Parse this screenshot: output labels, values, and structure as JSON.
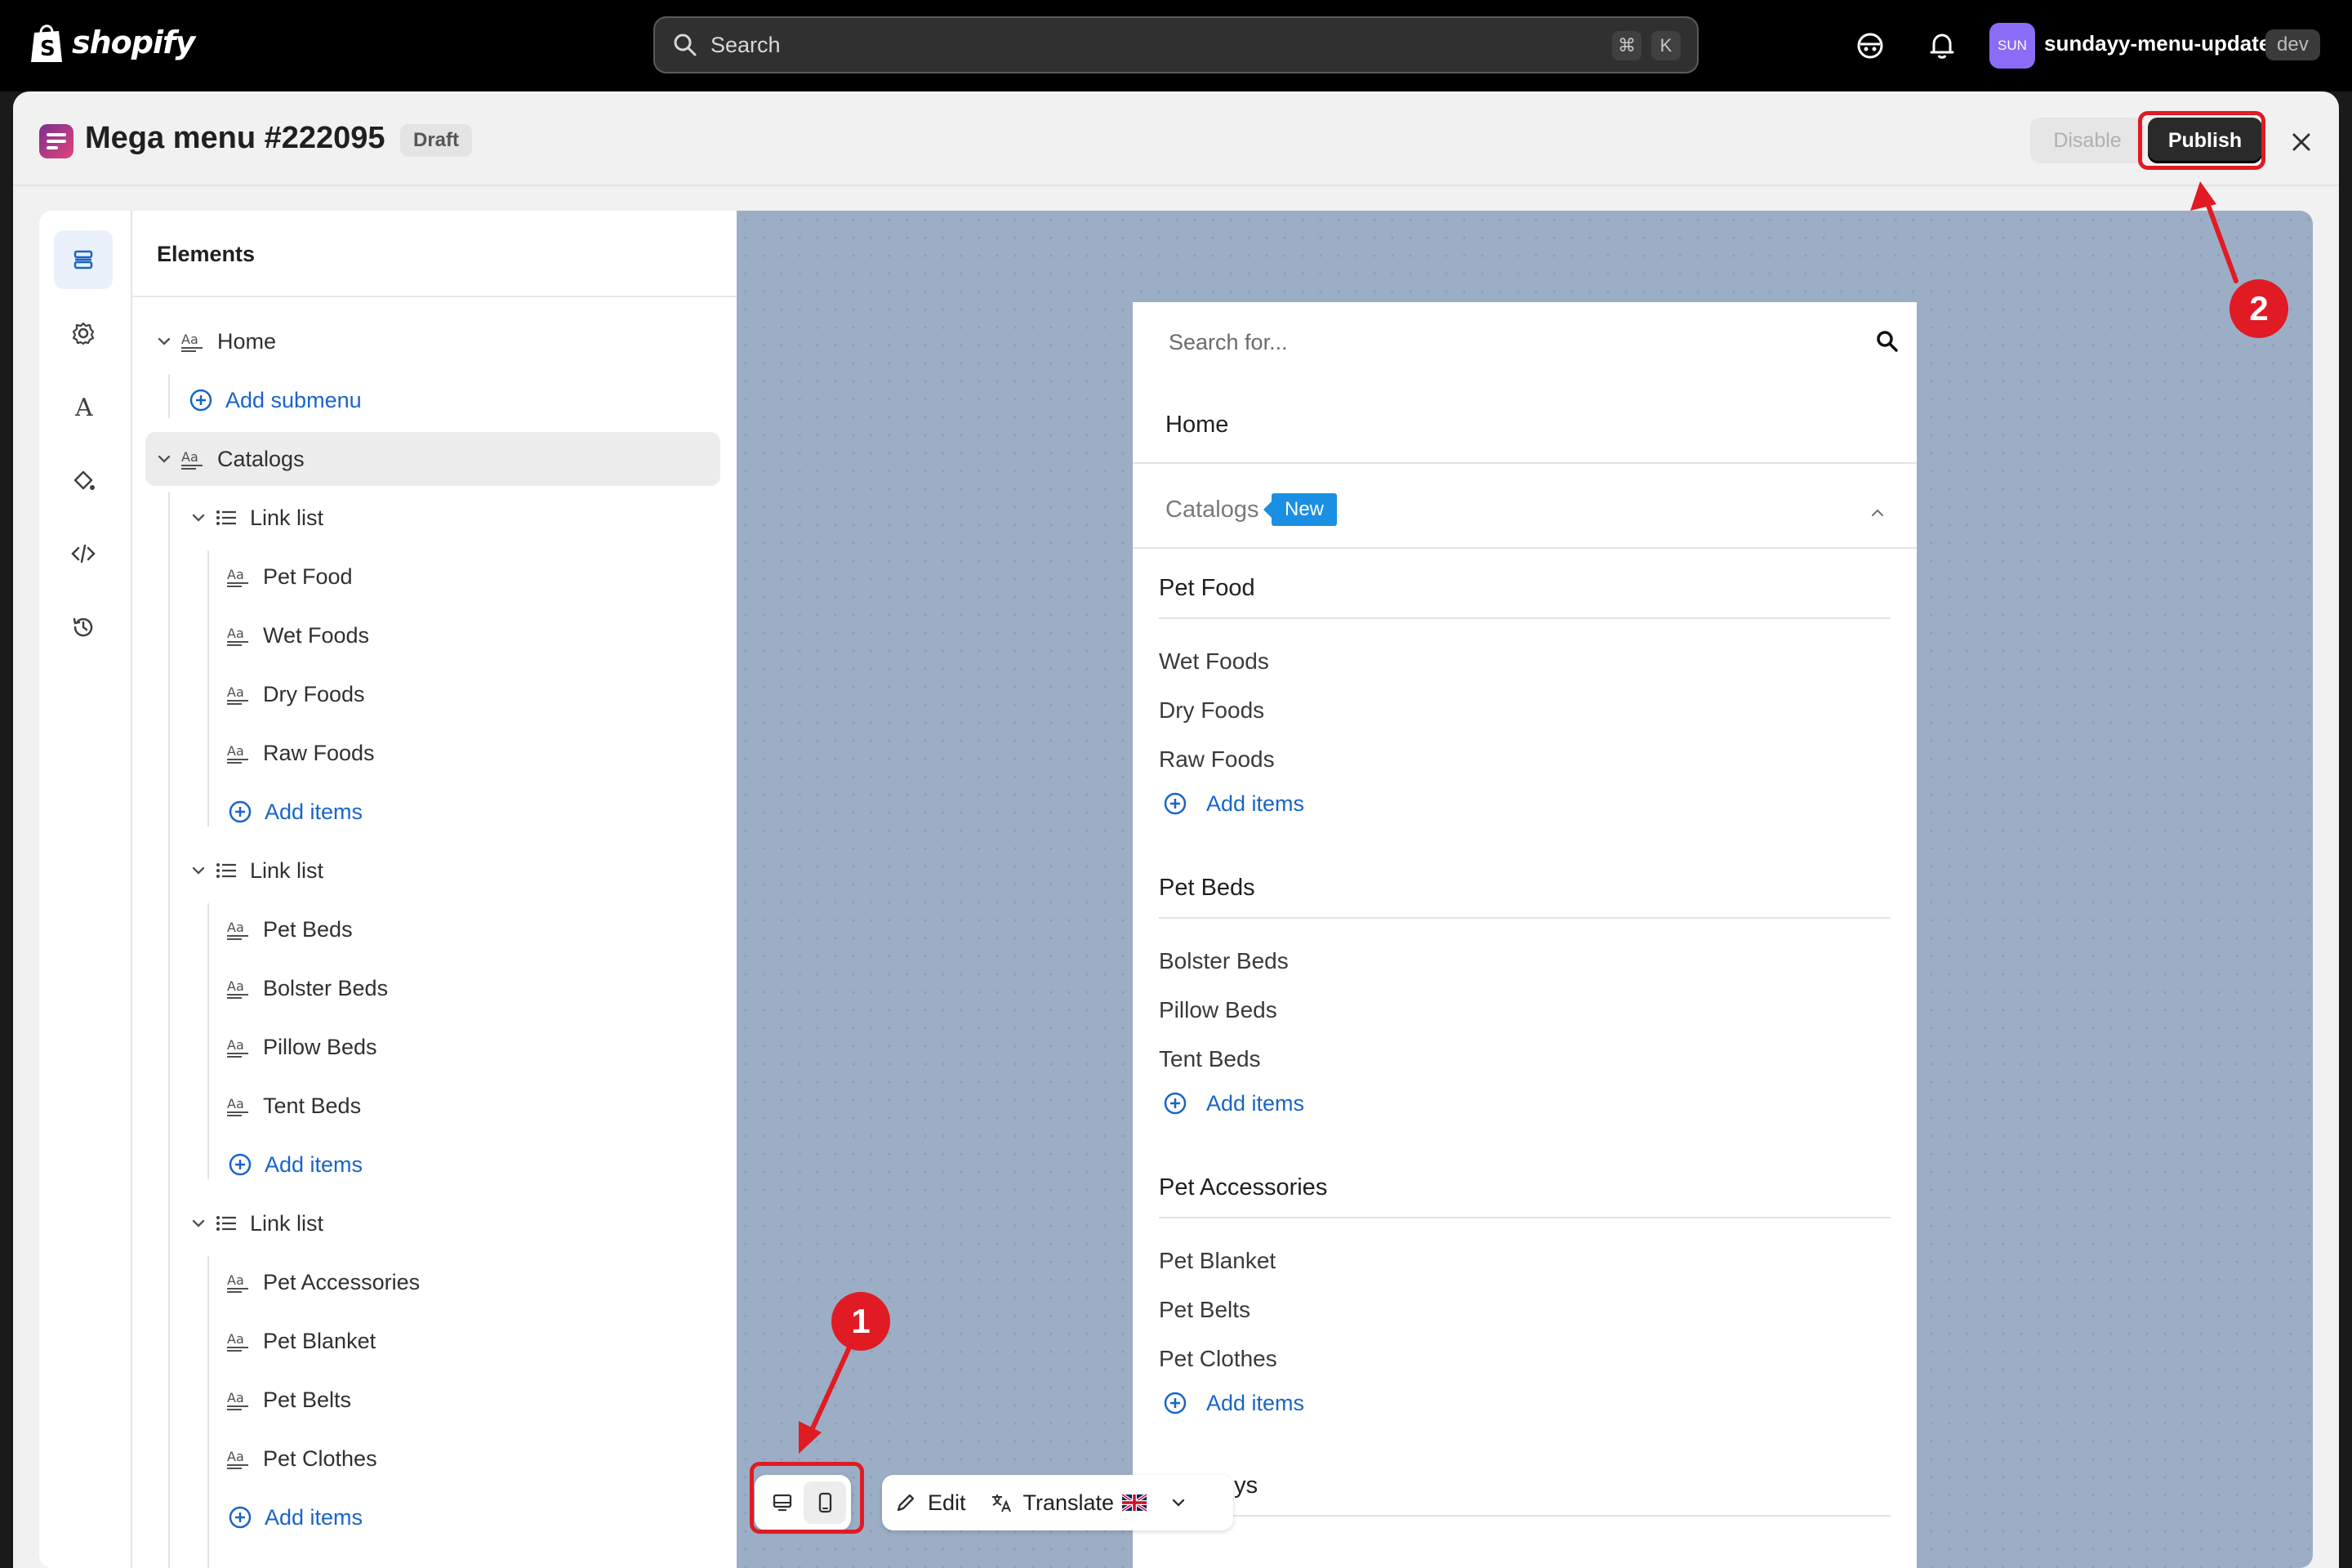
{
  "topbar": {
    "logo_text": "shopify",
    "search_placeholder": "Search",
    "kbd_cmd": "⌘",
    "kbd_key": "K",
    "store_avatar": "SUN",
    "store_name": "sundayy-menu-update",
    "store_tag": "dev"
  },
  "header": {
    "title": "Mega menu #222095",
    "status": "Draft",
    "disable_label": "Disable",
    "publish_label": "Publish"
  },
  "panel": {
    "title": "Elements",
    "tree": [
      {
        "label": "Home",
        "type": "heading"
      },
      {
        "label": "Add submenu",
        "type": "add"
      },
      {
        "label": "Catalogs",
        "type": "heading"
      },
      {
        "label": "Link list",
        "type": "list"
      },
      {
        "label": "Pet Food",
        "type": "item"
      },
      {
        "label": "Wet Foods",
        "type": "item"
      },
      {
        "label": "Dry Foods",
        "type": "item"
      },
      {
        "label": "Raw Foods",
        "type": "item"
      },
      {
        "label": "Add items",
        "type": "add"
      },
      {
        "label": "Link list",
        "type": "list"
      },
      {
        "label": "Pet Beds",
        "type": "item"
      },
      {
        "label": "Bolster Beds",
        "type": "item"
      },
      {
        "label": "Pillow Beds",
        "type": "item"
      },
      {
        "label": "Tent Beds",
        "type": "item"
      },
      {
        "label": "Add items",
        "type": "add"
      },
      {
        "label": "Link list",
        "type": "list"
      },
      {
        "label": "Pet Accessories",
        "type": "item"
      },
      {
        "label": "Pet Blanket",
        "type": "item"
      },
      {
        "label": "Pet Belts",
        "type": "item"
      },
      {
        "label": "Pet Clothes",
        "type": "item"
      },
      {
        "label": "Add items",
        "type": "add"
      }
    ]
  },
  "preview": {
    "search_placeholder": "Search for...",
    "home": "Home",
    "catalogs": "Catalogs",
    "new_badge": "New",
    "groups": [
      {
        "heading": "Pet Food",
        "items": [
          "Wet Foods",
          "Dry Foods",
          "Raw Foods"
        ],
        "add": "Add items"
      },
      {
        "heading": "Pet Beds",
        "items": [
          "Bolster Beds",
          "Pillow Beds",
          "Tent Beds"
        ],
        "add": "Add items"
      },
      {
        "heading": "Pet Accessories",
        "items": [
          "Pet Blanket",
          "Pet Belts",
          "Pet Clothes"
        ],
        "add": "Add items"
      }
    ],
    "partial_heading": "...ys"
  },
  "toolbar": {
    "edit_label": "Edit",
    "translate_label": "Translate"
  },
  "annotations": {
    "badge_1": "1",
    "badge_2": "2",
    "color": "#e01b24"
  }
}
